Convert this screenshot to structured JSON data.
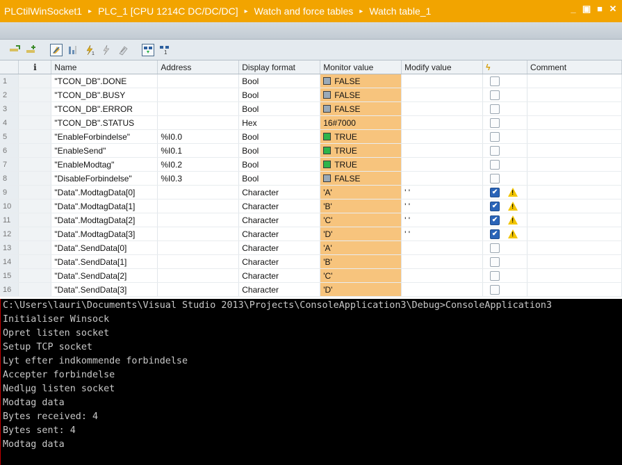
{
  "titlebar": {
    "crumbs": [
      "PLCtilWinSocket1",
      "PLC_1 [CPU 1214C DC/DC/DC]",
      "Watch and force tables",
      "Watch table_1"
    ],
    "separator": "▸",
    "controls": [
      "_",
      "▣",
      "■",
      "✕"
    ]
  },
  "table": {
    "headers": {
      "info": "i",
      "name": "Name",
      "address": "Address",
      "format": "Display format",
      "monitor": "Monitor value",
      "modify": "Modify value",
      "force": "ϟ",
      "comment": "Comment"
    },
    "rows": [
      {
        "n": "1",
        "name": "\"TCON_DB\".DONE",
        "address": "",
        "format": "Bool",
        "monitor": "FALSE",
        "bool": "false",
        "modify": "",
        "checked": false,
        "warn": false
      },
      {
        "n": "2",
        "name": "\"TCON_DB\".BUSY",
        "address": "",
        "format": "Bool",
        "monitor": "FALSE",
        "bool": "false",
        "modify": "",
        "checked": false,
        "warn": false
      },
      {
        "n": "3",
        "name": "\"TCON_DB\".ERROR",
        "address": "",
        "format": "Bool",
        "monitor": "FALSE",
        "bool": "false",
        "modify": "",
        "checked": false,
        "warn": false
      },
      {
        "n": "4",
        "name": "\"TCON_DB\".STATUS",
        "address": "",
        "format": "Hex",
        "monitor": "16#7000",
        "bool": "",
        "modify": "",
        "checked": false,
        "warn": false
      },
      {
        "n": "5",
        "name": "\"EnableForbindelse\"",
        "address": "%I0.0",
        "format": "Bool",
        "monitor": "TRUE",
        "bool": "true",
        "modify": "",
        "checked": false,
        "warn": false
      },
      {
        "n": "6",
        "name": "\"EnableSend\"",
        "address": "%I0.1",
        "format": "Bool",
        "monitor": "TRUE",
        "bool": "true",
        "modify": "",
        "checked": false,
        "warn": false
      },
      {
        "n": "7",
        "name": "\"EnableModtag\"",
        "address": "%I0.2",
        "format": "Bool",
        "monitor": "TRUE",
        "bool": "true",
        "modify": "",
        "checked": false,
        "warn": false
      },
      {
        "n": "8",
        "name": "\"DisableForbindelse\"",
        "address": "%I0.3",
        "format": "Bool",
        "monitor": "FALSE",
        "bool": "false",
        "modify": "",
        "checked": false,
        "warn": false
      },
      {
        "n": "9",
        "name": "\"Data\".ModtagData[0]",
        "address": "",
        "format": "Character",
        "monitor": "'A'",
        "bool": "",
        "modify": "' '",
        "checked": true,
        "warn": true
      },
      {
        "n": "10",
        "name": "\"Data\".ModtagData[1]",
        "address": "",
        "format": "Character",
        "monitor": "'B'",
        "bool": "",
        "modify": "' '",
        "checked": true,
        "warn": true
      },
      {
        "n": "11",
        "name": "\"Data\".ModtagData[2]",
        "address": "",
        "format": "Character",
        "monitor": "'C'",
        "bool": "",
        "modify": "' '",
        "checked": true,
        "warn": true
      },
      {
        "n": "12",
        "name": "\"Data\".ModtagData[3]",
        "address": "",
        "format": "Character",
        "monitor": "'D'",
        "bool": "",
        "modify": "' '",
        "checked": true,
        "warn": true
      },
      {
        "n": "13",
        "name": "\"Data\".SendData[0]",
        "address": "",
        "format": "Character",
        "monitor": "'A'",
        "bool": "",
        "modify": "",
        "checked": false,
        "warn": false
      },
      {
        "n": "14",
        "name": "\"Data\".SendData[1]",
        "address": "",
        "format": "Character",
        "monitor": "'B'",
        "bool": "",
        "modify": "",
        "checked": false,
        "warn": false
      },
      {
        "n": "15",
        "name": "\"Data\".SendData[2]",
        "address": "",
        "format": "Character",
        "monitor": "'C'",
        "bool": "",
        "modify": "",
        "checked": false,
        "warn": false
      },
      {
        "n": "16",
        "name": "\"Data\".SendData[3]",
        "address": "",
        "format": "Character",
        "monitor": "'D'",
        "bool": "",
        "modify": "",
        "checked": false,
        "warn": false
      }
    ]
  },
  "console": {
    "lines": [
      "C:\\Users\\lauri\\Documents\\Visual Studio 2013\\Projects\\ConsoleApplication3\\Debug>ConsoleApplication3",
      "Initialiser Winsock",
      "Opret listen socket",
      "Setup TCP socket",
      "Lyt efter indkommende forbindelse",
      "Accepter forbindelse",
      "Nedlµg listen socket",
      "Modtag data",
      "Bytes received: 4",
      "Bytes sent: 4",
      "Modtag data"
    ]
  }
}
